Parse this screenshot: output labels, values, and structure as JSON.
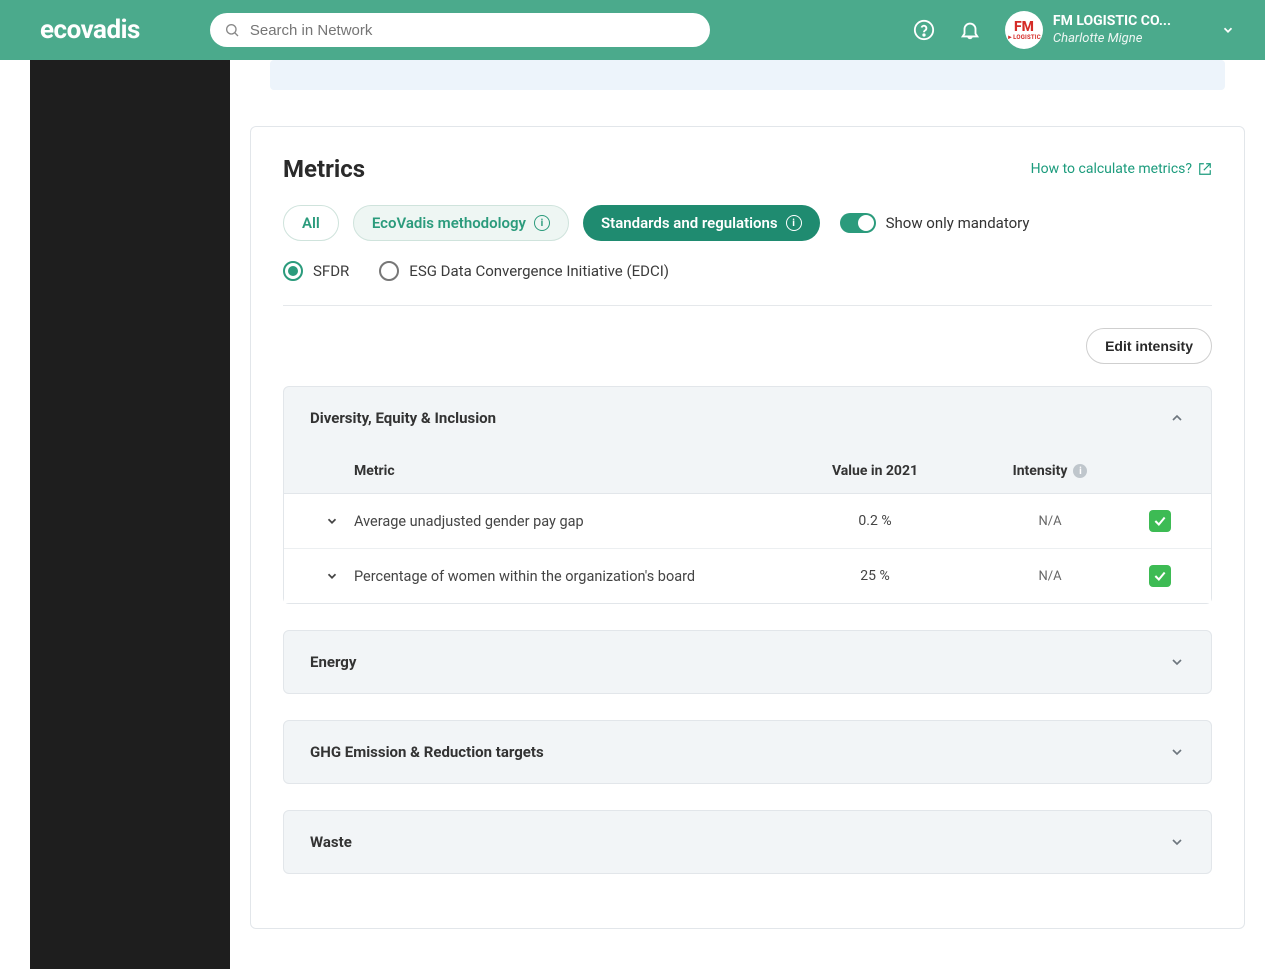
{
  "brand": "ecovadis",
  "search": {
    "placeholder": "Search in Network"
  },
  "user": {
    "company": "FM LOGISTIC CO...",
    "name": "Charlotte Migne",
    "avatar_top": "FM",
    "avatar_sub": "►LOGISTIC"
  },
  "section": {
    "title": "Metrics",
    "help_link": "How to calculate metrics?",
    "filters": {
      "all": "All",
      "eco": "EcoVadis methodology",
      "std": "Standards and regulations"
    },
    "mandatory_toggle": {
      "label": "Show only mandatory",
      "on": true
    },
    "radios": {
      "sfdr": "SFDR",
      "edci": "ESG Data Convergence Initiative (EDCI)"
    },
    "edit_intensity": "Edit intensity"
  },
  "table_labels": {
    "metric": "Metric",
    "value": "Value in 2021",
    "intensity": "Intensity"
  },
  "groups": [
    {
      "key": "diversity",
      "title": "Diversity, Equity & Inclusion",
      "open": true,
      "rows": [
        {
          "metric": "Average unadjusted gender pay gap",
          "value": "0.2 %",
          "intensity": "N/A",
          "checked": true
        },
        {
          "metric": "Percentage of women within the organization's board",
          "value": "25 %",
          "intensity": "N/A",
          "checked": true
        }
      ]
    },
    {
      "key": "energy",
      "title": "Energy",
      "open": false,
      "rows": []
    },
    {
      "key": "ghg",
      "title": "GHG Emission & Reduction targets",
      "open": false,
      "rows": []
    },
    {
      "key": "waste",
      "title": "Waste",
      "open": false,
      "rows": []
    }
  ]
}
